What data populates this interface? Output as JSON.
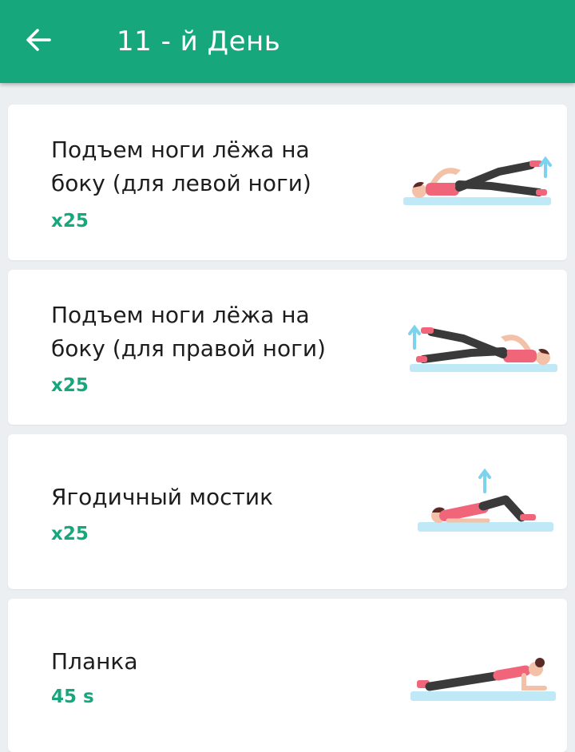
{
  "header": {
    "title": "11 - й День",
    "back_icon": "arrow-left-icon",
    "color": "#17a77c"
  },
  "exercises": [
    {
      "name": "Подъем ноги лёжа на боку (для левой ноги)",
      "reps": "x25",
      "icon": "side-lying-leg-raise-left-illustration"
    },
    {
      "name": "Подъем ноги лёжа на боку (для правой ноги)",
      "reps": "x25",
      "icon": "side-lying-leg-raise-right-illustration"
    },
    {
      "name": "Ягодичный мостик",
      "reps": "x25",
      "icon": "glute-bridge-illustration"
    },
    {
      "name": "Планка",
      "reps": "45 s",
      "icon": "plank-illustration"
    }
  ]
}
